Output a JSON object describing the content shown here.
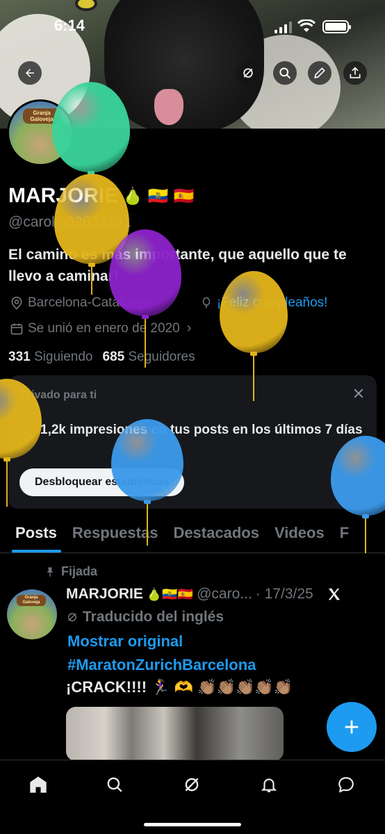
{
  "status_bar": {
    "time": "6:14"
  },
  "profile": {
    "name": "MARJORIE",
    "name_emoji": "🍐 🇪🇨 🇪🇸",
    "handle": "@carolin02632391",
    "bio": "El camino es más importante, que aquello que te llevo a caminar!",
    "location": "Barcelona-Catalunya",
    "birthday": "¡Feliz cumpleaños!",
    "joined": "Se unió en enero de 2020",
    "following_count": "331",
    "following_label": "Siguiendo",
    "followers_count": "685",
    "followers_label": "Seguidores",
    "avatar_text": "Granja Galoveja"
  },
  "private_card": {
    "title": "Privado para ti",
    "impressions": "1,2k impresiones en tus posts en los últimos 7 días",
    "button": "Desbloquear estadísticas"
  },
  "tabs": [
    "Posts",
    "Respuestas",
    "Destacados",
    "Videos",
    "F"
  ],
  "post": {
    "pinned": "Fijada",
    "name": "MARJORIE",
    "name_emoji": "🍐🇪🇨🇪🇸",
    "handle": "@caro...",
    "date": "· 17/3/25",
    "translated": "Traducido del inglés",
    "show_original": "Mostrar original",
    "hashtag": "#MaratonZurichBarcelona",
    "text": "¡CRACK!!!! 🏃‍♀️ 🫶 👏🏽👏🏽👏🏽👏🏽👏🏽",
    "avatar_text": "Granja Galoveja"
  },
  "icons": {
    "back": "back-arrow-icon",
    "grok": "grok-icon",
    "search": "search-icon",
    "edit": "pencil-icon",
    "share": "share-icon",
    "close": "close-icon",
    "pin": "pin-icon",
    "x_logo": "x-logo-icon",
    "compose": "plus-icon",
    "nav": [
      "home-icon",
      "search-icon",
      "grok-icon",
      "bell-icon",
      "messages-icon"
    ]
  },
  "colors": {
    "accent": "#1d9bf0",
    "balloon_green": "#3ad39b",
    "balloon_yellow": "#e2b41b",
    "balloon_purple": "#8b22c9",
    "balloon_blue": "#3b99ea"
  }
}
